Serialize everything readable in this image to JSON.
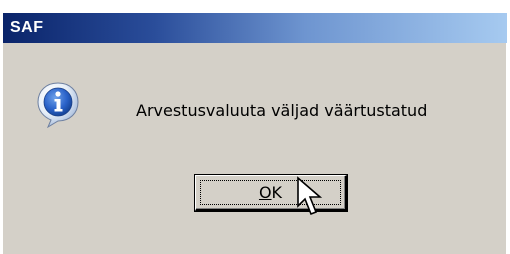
{
  "window": {
    "title": "SAF"
  },
  "dialog": {
    "icon": "info-icon",
    "message": "Arvestusvaluuta väljad väärtustatud",
    "ok_button": {
      "label_mnemonic": "O",
      "label_rest": "K"
    }
  },
  "colors": {
    "dialog_bg": "#d4d0c8",
    "titlebar_start": "#0a246a",
    "titlebar_end": "#a6caf0",
    "title_text": "#ffffff",
    "info_icon_blue": "#2a62c9"
  },
  "cursor": "arrow-cursor-icon"
}
